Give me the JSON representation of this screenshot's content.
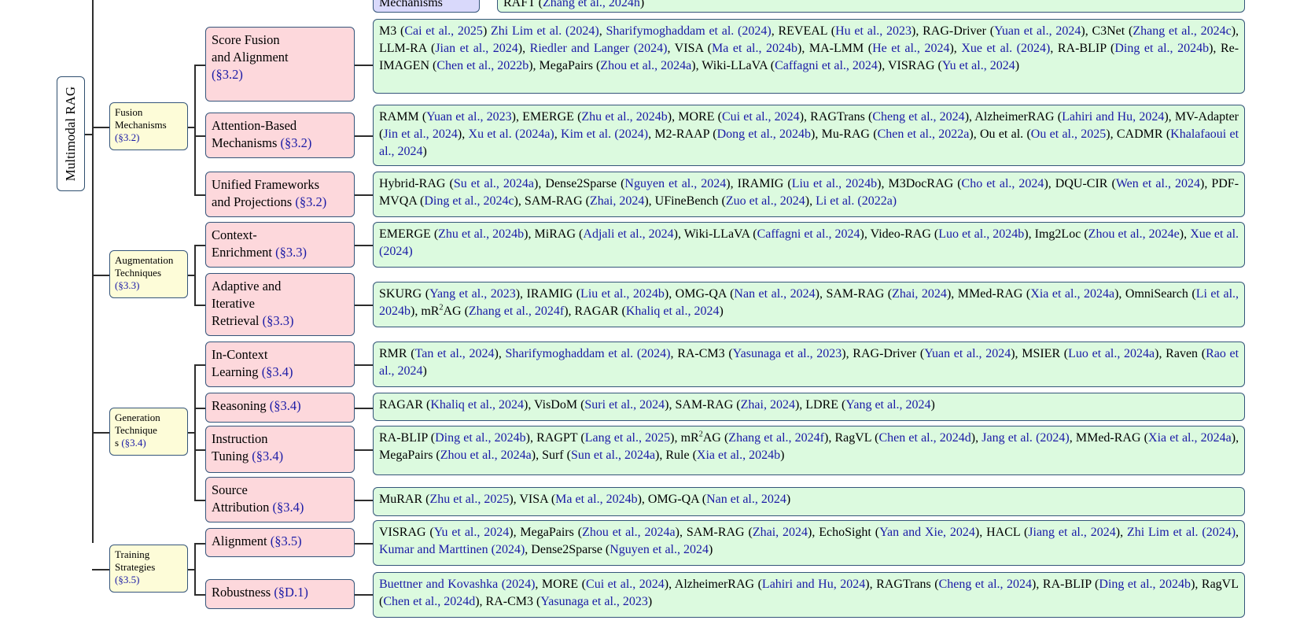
{
  "root_label": "Multimodal RAG",
  "top_partial": {
    "subcategory": "Mechanisms",
    "leaf": [
      {
        "t": "RAFT ("
      },
      {
        "c": "Zhang et al., 2024h"
      },
      {
        "t": ")"
      }
    ]
  },
  "categories": [
    {
      "id": "fusion",
      "label": "Fusion\nMechanisms\n(§3.2)",
      "subs": [
        {
          "label": "Score Fusion\nand Alignment\n(§3.2)",
          "leaf": [
            {
              "t": "M3 ("
            },
            {
              "c": "Cai et al., 2025"
            },
            {
              "t": ")  "
            },
            {
              "c": "Zhi Lim et al. (2024)"
            },
            {
              "t": ",  "
            },
            {
              "c": "Sharifymoghaddam et al. (2024)"
            },
            {
              "t": ", REVEAL ("
            },
            {
              "c": "Hu et al., 2023"
            },
            {
              "t": "), RAG-Driver ("
            },
            {
              "c": "Yuan et al., 2024"
            },
            {
              "t": "), C3Net ("
            },
            {
              "c": "Zhang et al., 2024c"
            },
            {
              "t": "), LLM-RA ("
            },
            {
              "c": "Jian et al., 2024"
            },
            {
              "t": "),  "
            },
            {
              "c": "Riedler and Langer (2024)"
            },
            {
              "t": ", VISA ("
            },
            {
              "c": "Ma et al., 2024b"
            },
            {
              "t": "), MA-LMM ("
            },
            {
              "c": "He et al., 2024"
            },
            {
              "t": "),  "
            },
            {
              "c": "Xue et al. (2024)"
            },
            {
              "t": ", RA-BLIP ("
            },
            {
              "c": "Ding et al., 2024b"
            },
            {
              "t": "), Re-IMAGEN ("
            },
            {
              "c": "Chen et al., 2022b"
            },
            {
              "t": "), MegaPairs ("
            },
            {
              "c": "Zhou et al., 2024a"
            },
            {
              "t": "), Wiki-LLaVA ("
            },
            {
              "c": "Caffagni et al., 2024"
            },
            {
              "t": "), VISRAG ("
            },
            {
              "c": "Yu et al., 2024"
            },
            {
              "t": ")"
            }
          ]
        },
        {
          "label": "Attention-Based\nMechanisms (§3.2)",
          "leaf": [
            {
              "t": "RAMM ("
            },
            {
              "c": "Yuan et al., 2023"
            },
            {
              "t": "), EMERGE ("
            },
            {
              "c": "Zhu et al., 2024b"
            },
            {
              "t": "), MORE ("
            },
            {
              "c": "Cui et al., 2024"
            },
            {
              "t": "), RAGTrans ("
            },
            {
              "c": "Cheng et al., 2024"
            },
            {
              "t": "), AlzheimerRAG ("
            },
            {
              "c": "Lahiri and Hu, 2024"
            },
            {
              "t": "), MV-Adapter ("
            },
            {
              "c": "Jin et al., 2024"
            },
            {
              "t": "),  "
            },
            {
              "c": "Xu et al. (2024a)"
            },
            {
              "t": ",  "
            },
            {
              "c": "Kim et al. (2024)"
            },
            {
              "t": ", M2-RAAP ("
            },
            {
              "c": "Dong et al., 2024b"
            },
            {
              "t": "), Mu-RAG ("
            },
            {
              "c": "Chen et al., 2022a"
            },
            {
              "t": "), Ou et al. ("
            },
            {
              "c": "Ou et al., 2025"
            },
            {
              "t": "), CADMR ("
            },
            {
              "c": "Khalafaoui et al., 2024"
            },
            {
              "t": ")"
            }
          ]
        },
        {
          "label": "Unified Frameworks\nand Projections (§3.2)",
          "leaf": [
            {
              "t": "Hybrid-RAG ("
            },
            {
              "c": "Su et al., 2024a"
            },
            {
              "t": "), Dense2Sparse ("
            },
            {
              "c": "Nguyen et al., 2024"
            },
            {
              "t": "), IRAMIG ("
            },
            {
              "c": "Liu et al., 2024b"
            },
            {
              "t": "), M3DocRAG ("
            },
            {
              "c": "Cho et al., 2024"
            },
            {
              "t": "), DQU-CIR ("
            },
            {
              "c": "Wen et al., 2024"
            },
            {
              "t": "), PDF-MVQA ("
            },
            {
              "c": "Ding et al., 2024c"
            },
            {
              "t": "), SAM-RAG ("
            },
            {
              "c": "Zhai, 2024"
            },
            {
              "t": "), UFineBench ("
            },
            {
              "c": "Zuo et al., 2024"
            },
            {
              "t": "),  "
            },
            {
              "c": "Li et al. (2022a)"
            }
          ]
        }
      ]
    },
    {
      "id": "augmentation",
      "label": "Augmentation\nTechniques\n(§3.3)",
      "subs": [
        {
          "label": "Context-\nEnrichment (§3.3)",
          "leaf": [
            {
              "t": "EMERGE ("
            },
            {
              "c": "Zhu et al., 2024b"
            },
            {
              "t": "), MiRAG ("
            },
            {
              "c": "Adjali et al., 2024"
            },
            {
              "t": "), Wiki-LLaVA ("
            },
            {
              "c": "Caffagni et al., 2024"
            },
            {
              "t": "), Video-RAG ("
            },
            {
              "c": "Luo et al., 2024b"
            },
            {
              "t": "), Img2Loc ("
            },
            {
              "c": "Zhou et al., 2024e"
            },
            {
              "t": "),  "
            },
            {
              "c": "Xue et al. (2024)"
            }
          ]
        },
        {
          "label": "Adaptive and\nIterative\nRetrieval (§3.3)",
          "leaf": [
            {
              "t": "SKURG ("
            },
            {
              "c": "Yang et al., 2023"
            },
            {
              "t": "), IRAMIG ("
            },
            {
              "c": "Liu et al., 2024b"
            },
            {
              "t": "), OMG-QA ("
            },
            {
              "c": "Nan et al., 2024"
            },
            {
              "t": "), SAM-RAG ("
            },
            {
              "c": "Zhai, 2024"
            },
            {
              "t": "), MMed-RAG ("
            },
            {
              "c": "Xia et al., 2024a"
            },
            {
              "t": "), OmniSearch ("
            },
            {
              "c": "Li et al., 2024b"
            },
            {
              "t": "), mR"
            },
            {
              "s": "2"
            },
            {
              "t": "AG ("
            },
            {
              "c": "Zhang et al., 2024f"
            },
            {
              "t": "), RAGAR ("
            },
            {
              "c": "Khaliq et al., 2024"
            },
            {
              "t": ")"
            }
          ]
        }
      ]
    },
    {
      "id": "generation",
      "label": "Generation\nTechnique\ns (§3.4)",
      "subs": [
        {
          "label": "In-Context\nLearning (§3.4)",
          "leaf": [
            {
              "t": "RMR ("
            },
            {
              "c": "Tan et al., 2024"
            },
            {
              "t": "),  "
            },
            {
              "c": "Sharifymoghaddam et al. (2024)"
            },
            {
              "t": ", RA-CM3 ("
            },
            {
              "c": "Yasunaga et al., 2023"
            },
            {
              "t": "), RAG-Driver ("
            },
            {
              "c": "Yuan et al., 2024"
            },
            {
              "t": "), MSIER ("
            },
            {
              "c": "Luo et al., 2024a"
            },
            {
              "t": "), Raven ("
            },
            {
              "c": "Rao et al., 2024"
            },
            {
              "t": ")"
            }
          ]
        },
        {
          "label": "Reasoning (§3.4)",
          "leaf": [
            {
              "t": "RAGAR ("
            },
            {
              "c": "Khaliq et al., 2024"
            },
            {
              "t": "), VisDoM ("
            },
            {
              "c": "Suri et al., 2024"
            },
            {
              "t": "), SAM-RAG ("
            },
            {
              "c": "Zhai, 2024"
            },
            {
              "t": "), LDRE ("
            },
            {
              "c": "Yang et al., 2024"
            },
            {
              "t": ")"
            }
          ]
        },
        {
          "label": "Instruction\nTuning (§3.4)",
          "leaf": [
            {
              "t": "RA-BLIP ("
            },
            {
              "c": "Ding et al., 2024b"
            },
            {
              "t": "), RAGPT ("
            },
            {
              "c": "Lang et al., 2025"
            },
            {
              "t": "), mR"
            },
            {
              "s": "2"
            },
            {
              "t": "AG ("
            },
            {
              "c": "Zhang et al., 2024f"
            },
            {
              "t": "), RagVL ("
            },
            {
              "c": "Chen et al., 2024d"
            },
            {
              "t": "), "
            },
            {
              "c": "Jang et al. (2024)"
            },
            {
              "t": ", MMed-RAG ("
            },
            {
              "c": "Xia et al., 2024a"
            },
            {
              "t": "), MegaPairs ("
            },
            {
              "c": "Zhou et al., 2024a"
            },
            {
              "t": "), Surf ("
            },
            {
              "c": "Sun et al., 2024a"
            },
            {
              "t": "), Rule ("
            },
            {
              "c": "Xia et al., 2024b"
            },
            {
              "t": ")"
            }
          ]
        },
        {
          "label": "Source\nAttribution (§3.4)",
          "leaf": [
            {
              "t": "MuRAR ("
            },
            {
              "c": "Zhu et al., 2025"
            },
            {
              "t": "), VISA ("
            },
            {
              "c": "Ma et al., 2024b"
            },
            {
              "t": "), OMG-QA ("
            },
            {
              "c": "Nan et al., 2024"
            },
            {
              "t": ")"
            }
          ]
        }
      ]
    },
    {
      "id": "training",
      "label": "Training\nStrategies\n(§3.5)",
      "subs": [
        {
          "label": "Alignment (§3.5)",
          "leaf": [
            {
              "t": "VISRAG ("
            },
            {
              "c": "Yu et al., 2024"
            },
            {
              "t": "), MegaPairs ("
            },
            {
              "c": "Zhou et al., 2024a"
            },
            {
              "t": "), SAM-RAG ("
            },
            {
              "c": "Zhai, 2024"
            },
            {
              "t": "), EchoSight ("
            },
            {
              "c": "Yan and Xie, 2024"
            },
            {
              "t": "), HACL ("
            },
            {
              "c": "Jiang et al., 2024"
            },
            {
              "t": "), "
            },
            {
              "c": "Zhi Lim et al. (2024)"
            },
            {
              "t": ",  "
            },
            {
              "c": "Kumar and Marttinen (2024)"
            },
            {
              "t": ", Dense2Sparse ("
            },
            {
              "c": "Nguyen et al., 2024"
            },
            {
              "t": ")"
            }
          ]
        },
        {
          "label": "Robustness (§D.1)",
          "leaf": [
            {
              "t": " "
            },
            {
              "c": "Buettner and Kovashka (2024)"
            },
            {
              "t": ", MORE ("
            },
            {
              "c": "Cui et al., 2024"
            },
            {
              "t": "), AlzheimerRAG ("
            },
            {
              "c": "Lahiri and Hu, 2024"
            },
            {
              "t": "), RAGTrans ("
            },
            {
              "c": "Cheng et al., 2024"
            },
            {
              "t": "), RA-BLIP ("
            },
            {
              "c": "Ding et al., 2024b"
            },
            {
              "t": "), RagVL ("
            },
            {
              "c": "Chen et al., 2024d"
            },
            {
              "t": "), RA-CM3 ("
            },
            {
              "c": "Yasunaga et al., 2023"
            },
            {
              "t": ")"
            }
          ]
        }
      ]
    }
  ]
}
